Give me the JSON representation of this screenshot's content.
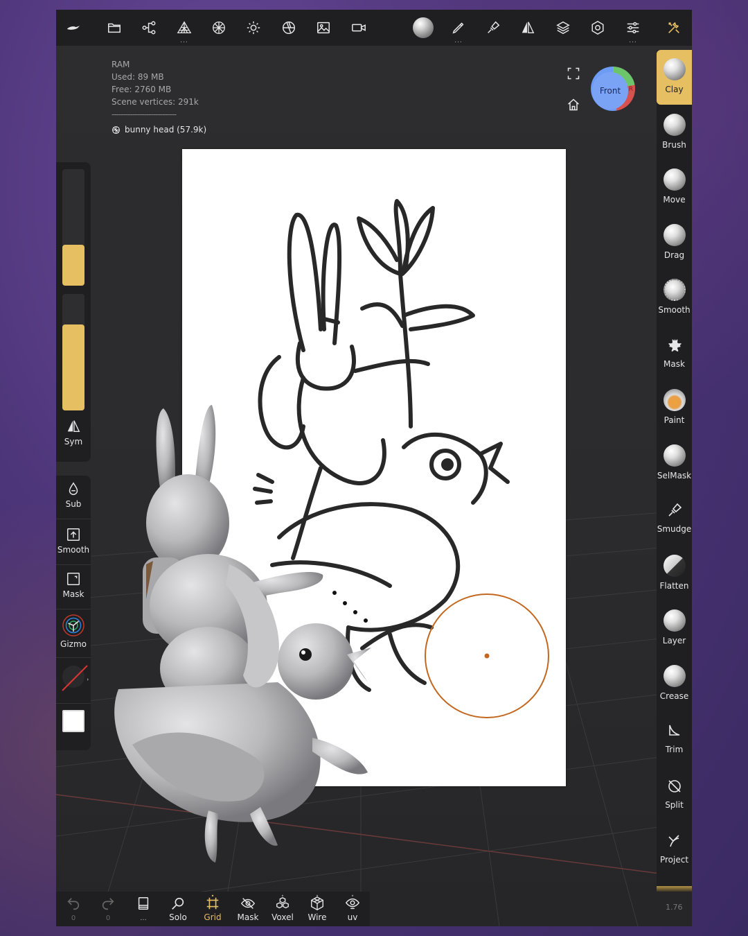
{
  "colors": {
    "accent": "#e6bf63",
    "panel": "#1f1f21",
    "viewport": "#2b2b2d",
    "brush_ring": "#c2671f"
  },
  "stats": {
    "ram_label": "RAM",
    "used": "Used: 89 MB",
    "free": "Free: 2760 MB",
    "vertices": "Scene vertices: 291k",
    "separator": "----------------------------",
    "mesh_name": "bunny head (57.9k)"
  },
  "view_cube": {
    "front_label": "Front",
    "right_label": "R"
  },
  "top_toolbar": [
    {
      "icon": "nomad-logo-icon"
    },
    {
      "icon": "folder-icon"
    },
    {
      "icon": "scene-graph-icon"
    },
    {
      "icon": "topology-icon",
      "dots": "..."
    },
    {
      "icon": "material-icon"
    },
    {
      "icon": "light-icon"
    },
    {
      "icon": "shading-icon"
    },
    {
      "icon": "background-image-icon"
    },
    {
      "icon": "camera-icon"
    },
    {
      "icon": "matcap-icon"
    },
    {
      "icon": "stroke-icon",
      "dots": "..."
    },
    {
      "icon": "brush-settings-icon"
    },
    {
      "icon": "symmetry-icon"
    },
    {
      "icon": "layers-icon"
    },
    {
      "icon": "settings-icon"
    },
    {
      "icon": "sliders-icon",
      "dots": "..."
    },
    {
      "icon": "tools-icon"
    }
  ],
  "left_panel": {
    "sym_label": "Sym",
    "sub_label": "Sub",
    "smooth_label": "Smooth",
    "mask_label": "Mask",
    "gizmo_label": "Gizmo",
    "radius_fraction": 0.35,
    "intensity_fraction": 0.74
  },
  "tools": [
    {
      "label": "Clay",
      "active": true
    },
    {
      "label": "Brush"
    },
    {
      "label": "Move"
    },
    {
      "label": "Drag"
    },
    {
      "label": "Smooth"
    },
    {
      "label": "Mask"
    },
    {
      "label": "Paint"
    },
    {
      "label": "SelMask"
    },
    {
      "label": "Smudge"
    },
    {
      "label": "Flatten"
    },
    {
      "label": "Layer"
    },
    {
      "label": "Crease"
    },
    {
      "label": "Trim"
    },
    {
      "label": "Split"
    },
    {
      "label": "Project"
    }
  ],
  "bottom_bar": {
    "undo_count": "0",
    "redo_count": "0",
    "notes_dots": "...",
    "solo": "Solo",
    "grid": "Grid",
    "mask": "Mask",
    "voxel": "Voxel",
    "wire": "Wire",
    "uv": "uv"
  },
  "version": "1.76"
}
